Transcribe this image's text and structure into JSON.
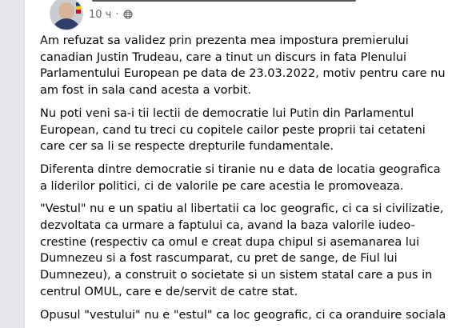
{
  "post": {
    "time": "10 ч",
    "dot": "·",
    "privacy_icon": "globe-icon",
    "author_avatar_icon": "profile-avatar"
  },
  "paragraphs": [
    {
      "lines": [
        "Am refuzat sa validez prin prezenta mea impostura premierului",
        "canadian Justin Trudeau, care a tinut un discurs in fata Plenului",
        "Parlamentului European pe data de 23.03.2022, motiv pentru care nu",
        "am fost in sala cand acesta a vorbit."
      ]
    },
    {
      "lines": [
        "Nu poti veni sa-i tii lectii de democratie lui Putin din Parlamentul",
        "European, cand tu treci cu copitele cailor peste proprii tai cetateni",
        "care cer sa li se respecte drepturile fundamentale."
      ]
    },
    {
      "lines": [
        "Diferenta dintre democratie si tiranie nu e data de locatia geografica",
        "a liderilor politici, ci de valorile pe care acestia le promoveaza."
      ]
    },
    {
      "lines": [
        "\"Vestul\" nu e un spatiu al libertatii ca loc geografic, ci ca si civilizatie,",
        "dezvoltata ca urmare a faptului ca, avand la baza valorile iudeo-",
        "crestine (respectiv ca omul e creat dupa chipul si asemanarea lui",
        "Dumnezeu si a fost rascumparat, cu pret de sange, de Fiul lui",
        "Dumnezeu), a construit o societate si un sistem statal care a pus in",
        "centrul OMUL, care e de/servit de catre stat."
      ]
    },
    {
      "lines": [
        "Opusul \"vestului\" nu e \"estul\" ca loc geografic, ci ca oranduire sociala"
      ]
    }
  ]
}
